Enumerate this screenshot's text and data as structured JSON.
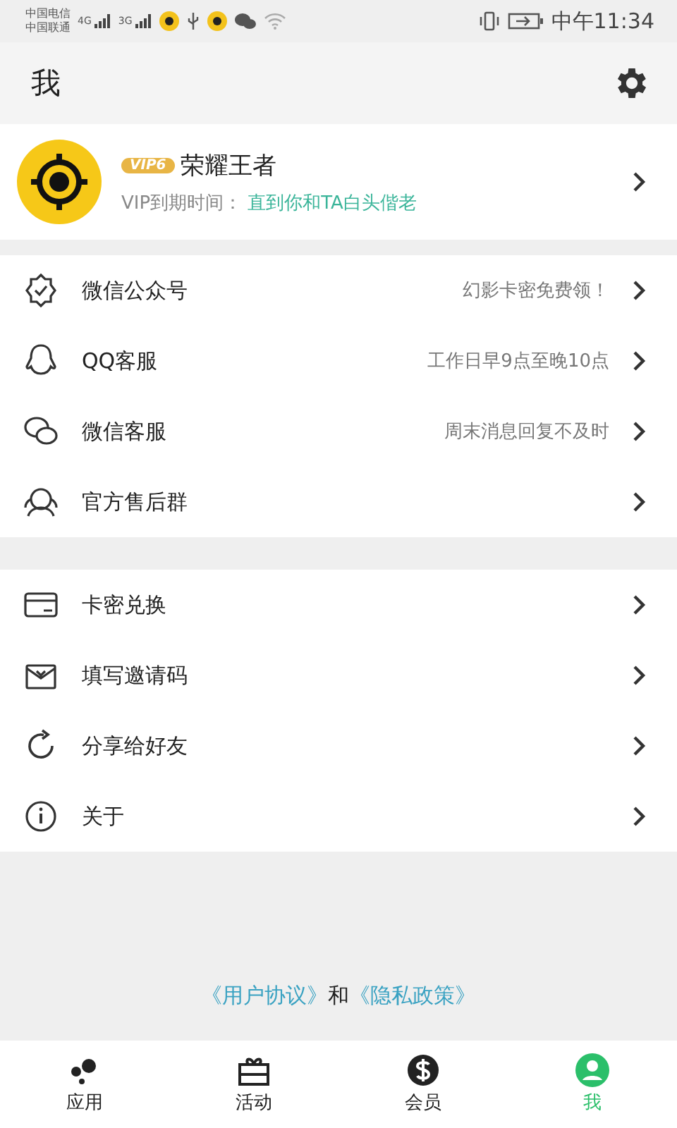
{
  "status_bar": {
    "carriers": [
      "中国电信",
      "中国联通"
    ],
    "networks": [
      "4G",
      "3G"
    ],
    "time": "中午11:34"
  },
  "header": {
    "title": "我"
  },
  "profile": {
    "badge": "VIP6",
    "name": "荣耀王者",
    "vip_label": "VIP到期时间：",
    "vip_value": "直到你和TA白头偕老"
  },
  "groups": [
    [
      {
        "kind": "badge",
        "label": "微信公众号",
        "note": "幻影卡密免费领！"
      },
      {
        "kind": "qq",
        "label": "QQ客服",
        "note": "工作日早9点至晚10点"
      },
      {
        "kind": "chat",
        "label": "微信客服",
        "note": "周末消息回复不及时"
      },
      {
        "kind": "group",
        "label": "官方售后群"
      }
    ],
    [
      {
        "kind": "card",
        "label": "卡密兑换"
      },
      {
        "kind": "mail",
        "label": "填写邀请码"
      },
      {
        "kind": "share",
        "label": "分享给好友"
      },
      {
        "kind": "info",
        "label": "关于"
      }
    ]
  ],
  "footer": {
    "links": [
      "《用户协议》",
      "《隐私政策》"
    ],
    "joiner": "和"
  },
  "tabs": [
    {
      "kind": "apps",
      "label": "应用",
      "selected": false
    },
    {
      "kind": "gift",
      "label": "活动",
      "selected": false
    },
    {
      "kind": "coin",
      "label": "会员",
      "selected": false
    },
    {
      "kind": "user",
      "label": "我",
      "selected": true
    }
  ]
}
